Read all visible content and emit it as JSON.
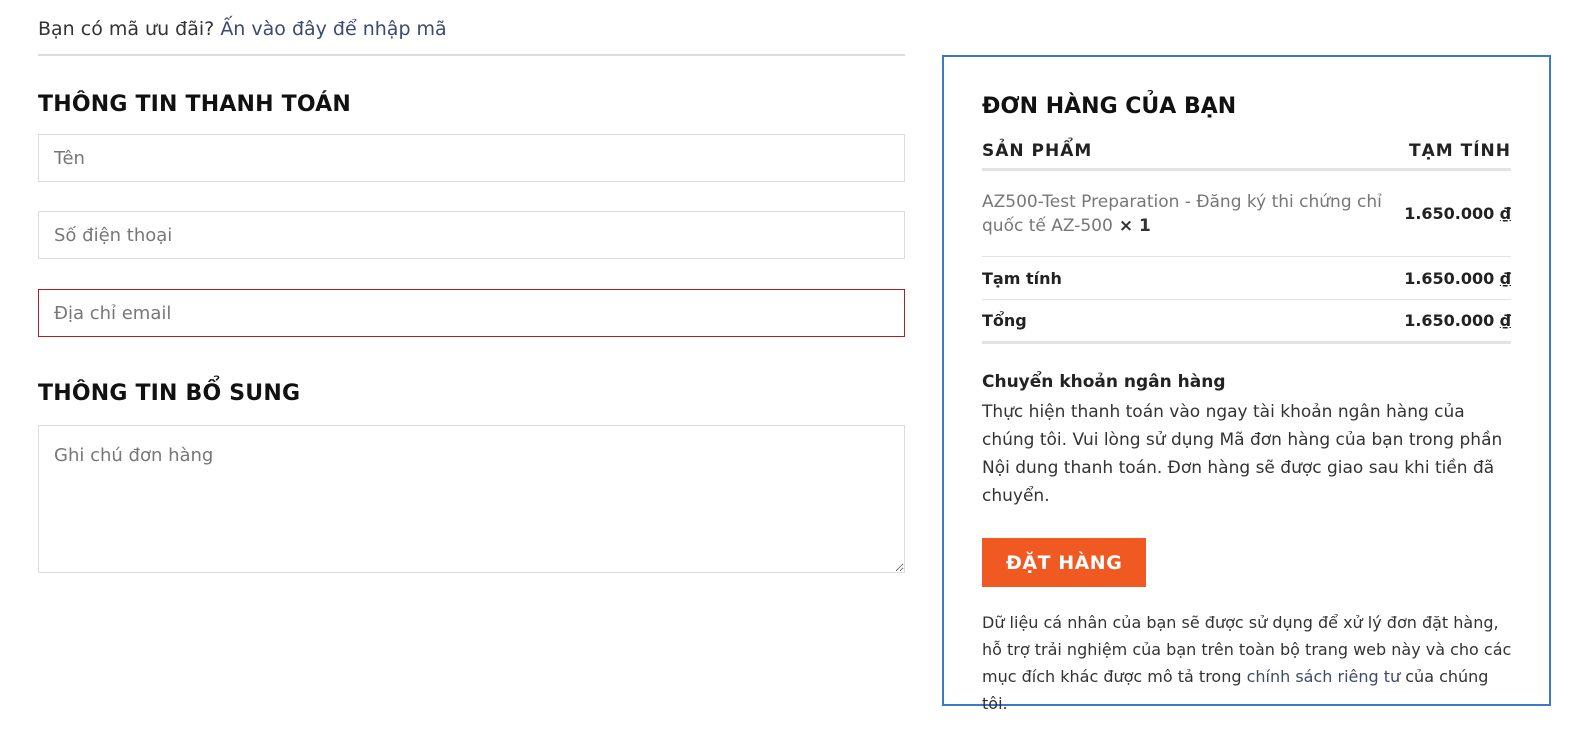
{
  "coupon": {
    "question": "Bạn có mã ưu đãi?",
    "link": "Ấn vào đây để nhập mã"
  },
  "billing": {
    "heading": "THÔNG TIN THANH TOÁN",
    "name_placeholder": "Tên",
    "phone_placeholder": "Số điện thoại",
    "email_placeholder": "Địa chỉ email"
  },
  "additional": {
    "heading": "THÔNG TIN BỔ SUNG",
    "notes_placeholder": "Ghi chú đơn hàng"
  },
  "order": {
    "title": "ĐƠN HÀNG CỦA BẠN",
    "col_product": "SẢN PHẨM",
    "col_subtotal": "TẠM TÍNH",
    "item": {
      "name": "AZ500-Test Preparation - Đăng ký thi chứng chỉ quốc tế AZ-500",
      "qty": "× 1",
      "price": "1.650.000",
      "currency": "₫"
    },
    "subtotal_label": "Tạm tính",
    "subtotal_value": "1.650.000",
    "subtotal_currency": "₫",
    "total_label": "Tổng",
    "total_value": "1.650.000",
    "total_currency": "₫"
  },
  "payment": {
    "title": "Chuyển khoản ngân hàng",
    "description": "Thực hiện thanh toán vào ngay tài khoản ngân hàng của chúng tôi. Vui lòng sử dụng Mã đơn hàng của bạn trong phần Nội dung thanh toán. Đơn hàng sẽ được giao sau khi tiền đã chuyển."
  },
  "place_order_label": "ĐẶT HÀNG",
  "privacy": {
    "text_before": "Dữ liệu cá nhân của bạn sẽ được sử dụng để xử lý đơn đặt hàng, hỗ trợ trải nghiệm của bạn trên toàn bộ trang web này và cho các mục đích khác được mô tả trong ",
    "link": "chính sách riêng tư",
    "text_after": " của chúng tôi."
  },
  "colors": {
    "accent_button": "#f05a22",
    "order_box_border": "#3b79c9",
    "error_border": "#b31c24",
    "link": "#3c4a6b"
  }
}
